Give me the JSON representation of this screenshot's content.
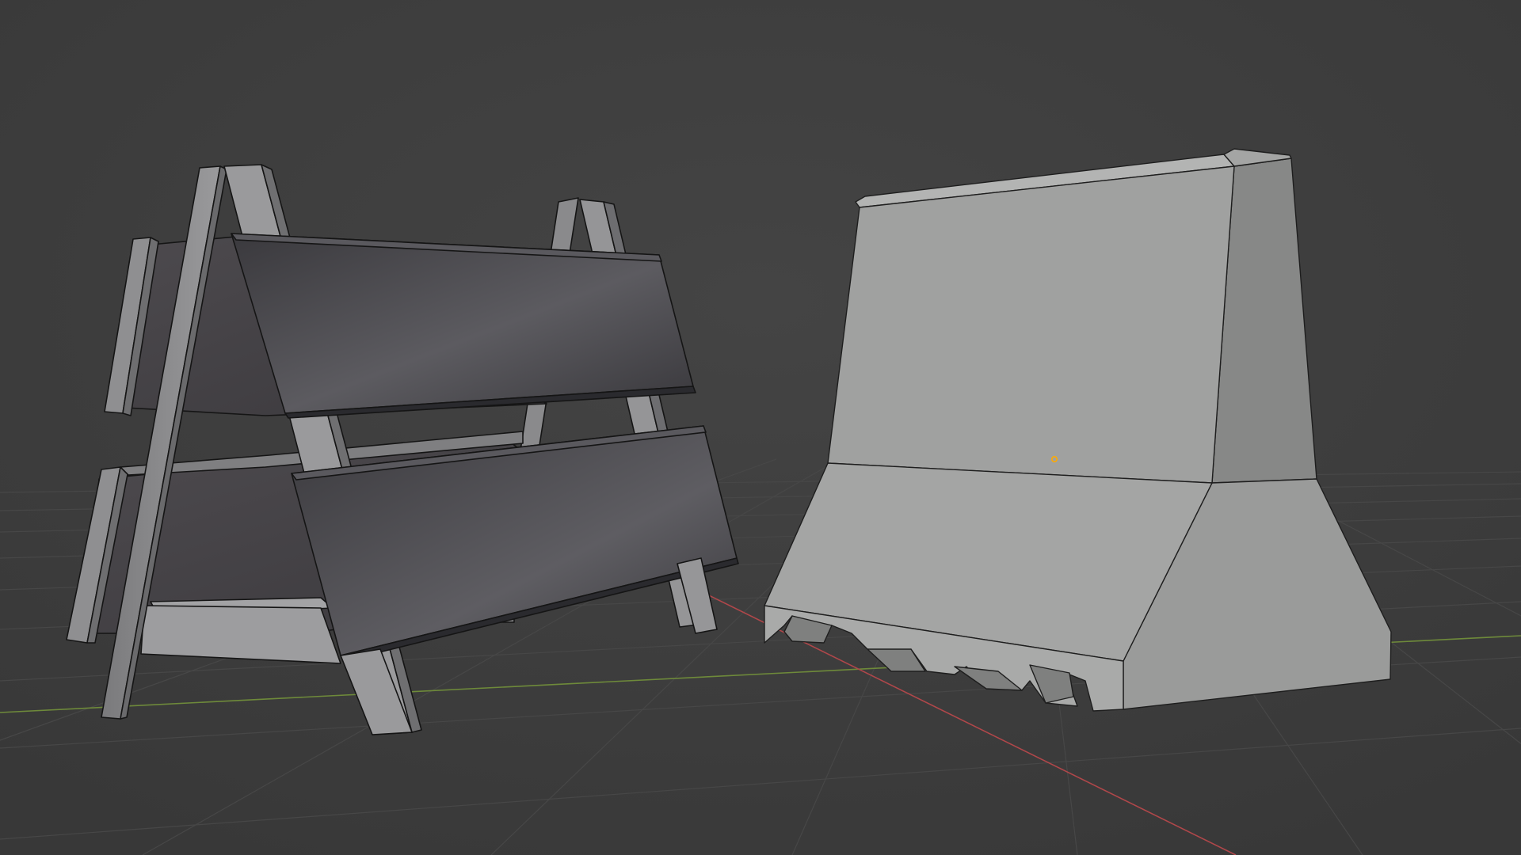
{
  "app": {
    "view": "3d-viewport",
    "shading": "solid"
  },
  "viewport": {
    "background_color": "#3d3d3d",
    "grid_color": "#4a4a4a",
    "x_axis_color": "#b0474a",
    "y_axis_color": "#6e8a3a",
    "origin_marker_color": "#ffaa00"
  },
  "objects": [
    {
      "name": "sawhorse-barricade",
      "material_color": "#4a4a4e",
      "frame_color": "#8e8e8e"
    },
    {
      "name": "jersey-barrier",
      "material_color": "#9fa09f"
    }
  ]
}
